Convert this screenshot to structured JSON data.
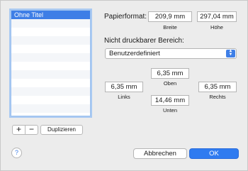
{
  "list": {
    "items": [
      "Ohne Titel",
      "",
      "",
      "",
      "",
      "",
      "",
      "",
      "",
      "",
      "",
      ""
    ]
  },
  "list_buttons": {
    "add": "+",
    "remove": "−",
    "duplicate": "Duplizieren"
  },
  "paper": {
    "label": "Papierformat:",
    "width": {
      "value": "209,9 mm",
      "caption": "Breite"
    },
    "height": {
      "value": "297,04 mm",
      "caption": "Höhe"
    }
  },
  "margins": {
    "label": "Nicht druckbarer Bereich:",
    "preset": "Benutzerdefiniert",
    "top": {
      "value": "6,35 mm",
      "caption": "Oben"
    },
    "left": {
      "value": "6,35 mm",
      "caption": "Links"
    },
    "right": {
      "value": "6,35 mm",
      "caption": "Rechts"
    },
    "bottom": {
      "value": "14,46 mm",
      "caption": "Unten"
    }
  },
  "footer": {
    "help": "?",
    "cancel": "Abbrechen",
    "ok": "OK"
  },
  "colors": {
    "accent": "#3f7fe7",
    "selection": "#3e7ee6",
    "background": "#ececec"
  },
  "icons": {
    "select_arrow": "chevron-updown-icon",
    "help": "help-icon"
  }
}
